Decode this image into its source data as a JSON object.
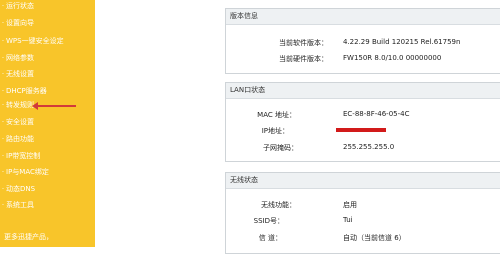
{
  "sidebar": {
    "items": [
      {
        "label": "运行状态"
      },
      {
        "label": "设置向导"
      },
      {
        "label": "WPS一键安全设定"
      },
      {
        "label": "网络参数"
      },
      {
        "label": "无线设置"
      },
      {
        "label": "DHCP服务器"
      },
      {
        "label": "转发规则"
      },
      {
        "label": "安全设置"
      },
      {
        "label": "路由功能"
      },
      {
        "label": "IP带宽控制"
      },
      {
        "label": "IP与MAC绑定"
      },
      {
        "label": "动态DNS"
      },
      {
        "label": "系统工具"
      },
      {
        "label": "更多迅捷产品，"
      }
    ],
    "bullet": "·",
    "colors": {
      "background": "#f8c52a",
      "arrow": "#d23a3a"
    }
  },
  "version_panel": {
    "title": "版本信息",
    "rows": [
      {
        "label": "当前软件版本：",
        "value": "4.22.29 Build 120215 Rel.61759n"
      },
      {
        "label": "当前硬件版本：",
        "value": "FW150R 8.0/10.0 00000000"
      }
    ]
  },
  "lan_panel": {
    "title": "LAN口状态",
    "rows": [
      {
        "label": "MAC 地址：",
        "value": "EC-88-8F-46-05-4C"
      },
      {
        "label": "IP地址：",
        "value": ""
      },
      {
        "label": "子网掩码：",
        "value": "255.255.255.0"
      }
    ],
    "redacted_color": "#d21a1a"
  },
  "wireless_panel": {
    "title": "无线状态",
    "rows": [
      {
        "label": "无线功能：",
        "value": "启用"
      },
      {
        "label": "SSID号：",
        "value": "Tui"
      },
      {
        "label": "信 道：",
        "value": "自动（当前信道 6）"
      }
    ]
  }
}
